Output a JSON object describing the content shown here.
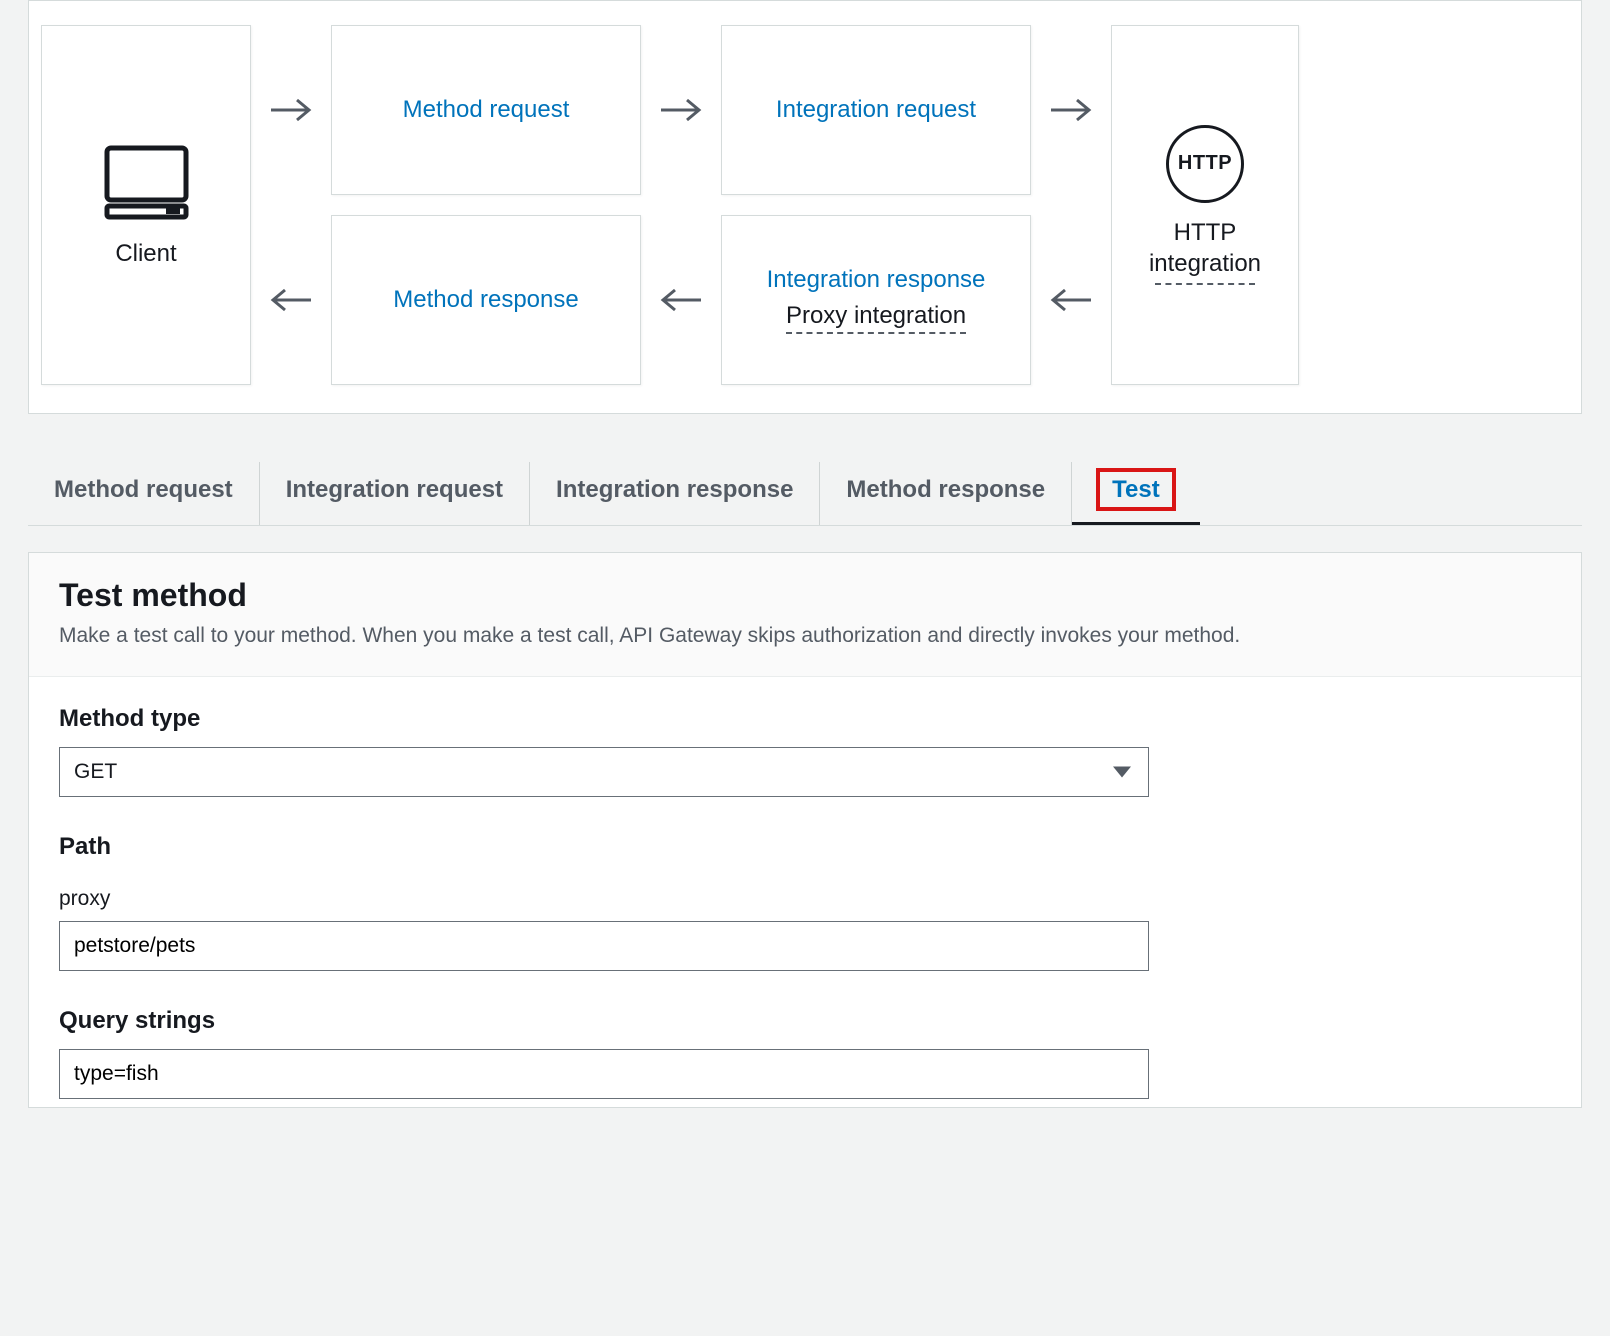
{
  "diagram": {
    "client_label": "Client",
    "method_request": "Method request",
    "integration_request": "Integration request",
    "method_response": "Method response",
    "integration_response": "Integration response",
    "proxy_integration": "Proxy integration",
    "http_badge": "HTTP",
    "http_integration": "HTTP integration"
  },
  "tabs": {
    "method_request": "Method request",
    "integration_request": "Integration request",
    "integration_response": "Integration response",
    "method_response": "Method response",
    "test": "Test"
  },
  "form": {
    "title": "Test method",
    "subtitle": "Make a test call to your method. When you make a test call, API Gateway skips authorization and directly invokes your method.",
    "method_type_label": "Method type",
    "method_type_value": "GET",
    "path_label": "Path",
    "proxy_label": "proxy",
    "proxy_value": "petstore/pets",
    "query_strings_label": "Query strings",
    "query_strings_value": "type=fish"
  }
}
